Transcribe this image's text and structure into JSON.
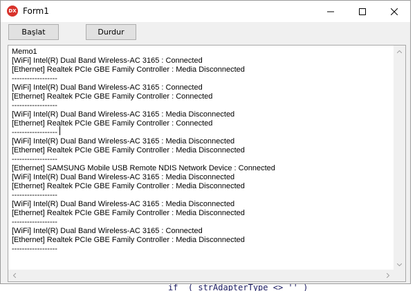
{
  "window": {
    "title": "Form1",
    "app_icon_text": "DX"
  },
  "toolbar": {
    "start_label": "Başlat",
    "stop_label": "Durdur"
  },
  "memo": {
    "lines": [
      "Memo1",
      "[WiFi] Intel(R) Dual Band Wireless-AC 3165 : Connected",
      "[Ethernet] Realtek PCIe GBE Family Controller : Media Disconnected",
      "------------------",
      "[WiFi] Intel(R) Dual Band Wireless-AC 3165 : Connected",
      "[Ethernet] Realtek PCIe GBE Family Controller : Connected",
      "------------------",
      "[WiFi] Intel(R) Dual Band Wireless-AC 3165 : Media Disconnected",
      "[Ethernet] Realtek PCIe GBE Family Controller : Connected",
      "------------------",
      "[WiFi] Intel(R) Dual Band Wireless-AC 3165 : Media Disconnected",
      "[Ethernet] Realtek PCIe GBE Family Controller : Media Disconnected",
      "------------------",
      "[Ethernet] SAMSUNG Mobile USB Remote NDIS Network Device : Connected",
      "[WiFi] Intel(R) Dual Band Wireless-AC 3165 : Media Disconnected",
      "[Ethernet] Realtek PCIe GBE Family Controller : Media Disconnected",
      "------------------",
      "[WiFi] Intel(R) Dual Band Wireless-AC 3165 : Media Disconnected",
      "[Ethernet] Realtek PCIe GBE Family Controller : Media Disconnected",
      "------------------",
      "[WiFi] Intel(R) Dual Band Wireless-AC 3165 : Connected",
      "[Ethernet] Realtek PCIe GBE Family Controller : Media Disconnected",
      "------------------"
    ]
  },
  "background": {
    "code_fragment": "if  ( strAdapterType <> '' )"
  },
  "icons": {
    "app": "devexpress-app-icon",
    "minimize": "minimize-icon",
    "maximize": "maximize-icon",
    "close": "close-icon",
    "scroll_up": "scroll-up-arrow-icon",
    "scroll_down": "scroll-down-arrow-icon",
    "scroll_left": "scroll-left-arrow-icon",
    "scroll_right": "scroll-right-arrow-icon"
  },
  "colors": {
    "app_icon": "#d8322b",
    "titlebar": "#ffffff",
    "client_area": "#f0f0f0",
    "button_face": "#e1e1e1"
  }
}
